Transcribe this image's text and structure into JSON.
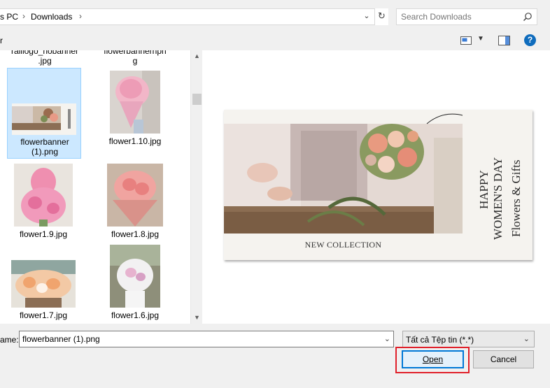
{
  "breadcrumb": {
    "items": [
      "s PC",
      "Downloads"
    ],
    "separator": "›"
  },
  "search": {
    "placeholder": "Search Downloads"
  },
  "command_bar": {
    "left_label": "r"
  },
  "files": [
    {
      "name": "ralllogo_nobanner.jpg",
      "line1": "ralllogo_nobanner",
      "line2": ".jpg",
      "selected": false
    },
    {
      "name": "flowerbannerhpng",
      "line1": "flowerbannerhpn",
      "line2": "g",
      "selected": false
    },
    {
      "name": "flowerbanner (1).png",
      "line1": "flowerbanner",
      "line2": "(1).png",
      "selected": true
    },
    {
      "name": "flower1.10.jpg",
      "line1": "flower1.10.jpg",
      "line2": "",
      "selected": false
    },
    {
      "name": "flower1.9.jpg",
      "line1": "flower1.9.jpg",
      "line2": "",
      "selected": false
    },
    {
      "name": "flower1.8.jpg",
      "line1": "flower1.8.jpg",
      "line2": "",
      "selected": false
    },
    {
      "name": "flower1.7.jpg",
      "line1": "flower1.7.jpg",
      "line2": "",
      "selected": false
    },
    {
      "name": "flower1.6.jpg",
      "line1": "flower1.6.jpg",
      "line2": "",
      "selected": false
    }
  ],
  "preview": {
    "caption": "NEW COLLECTION",
    "line1": "HAPPY",
    "line2": "WOMEN'S DAY",
    "line3": "Flowers & Gifts"
  },
  "bottom": {
    "filename_label": "ame:",
    "filename_value": "flowerbanner (1).png",
    "filter_value": "Tất cả Tệp tin (*.*)",
    "open_label": "Open",
    "cancel_label": "Cancel"
  },
  "colors": {
    "accent": "#0078d7",
    "selection_bg": "#cce8ff",
    "highlight_outline": "#e0202a"
  }
}
